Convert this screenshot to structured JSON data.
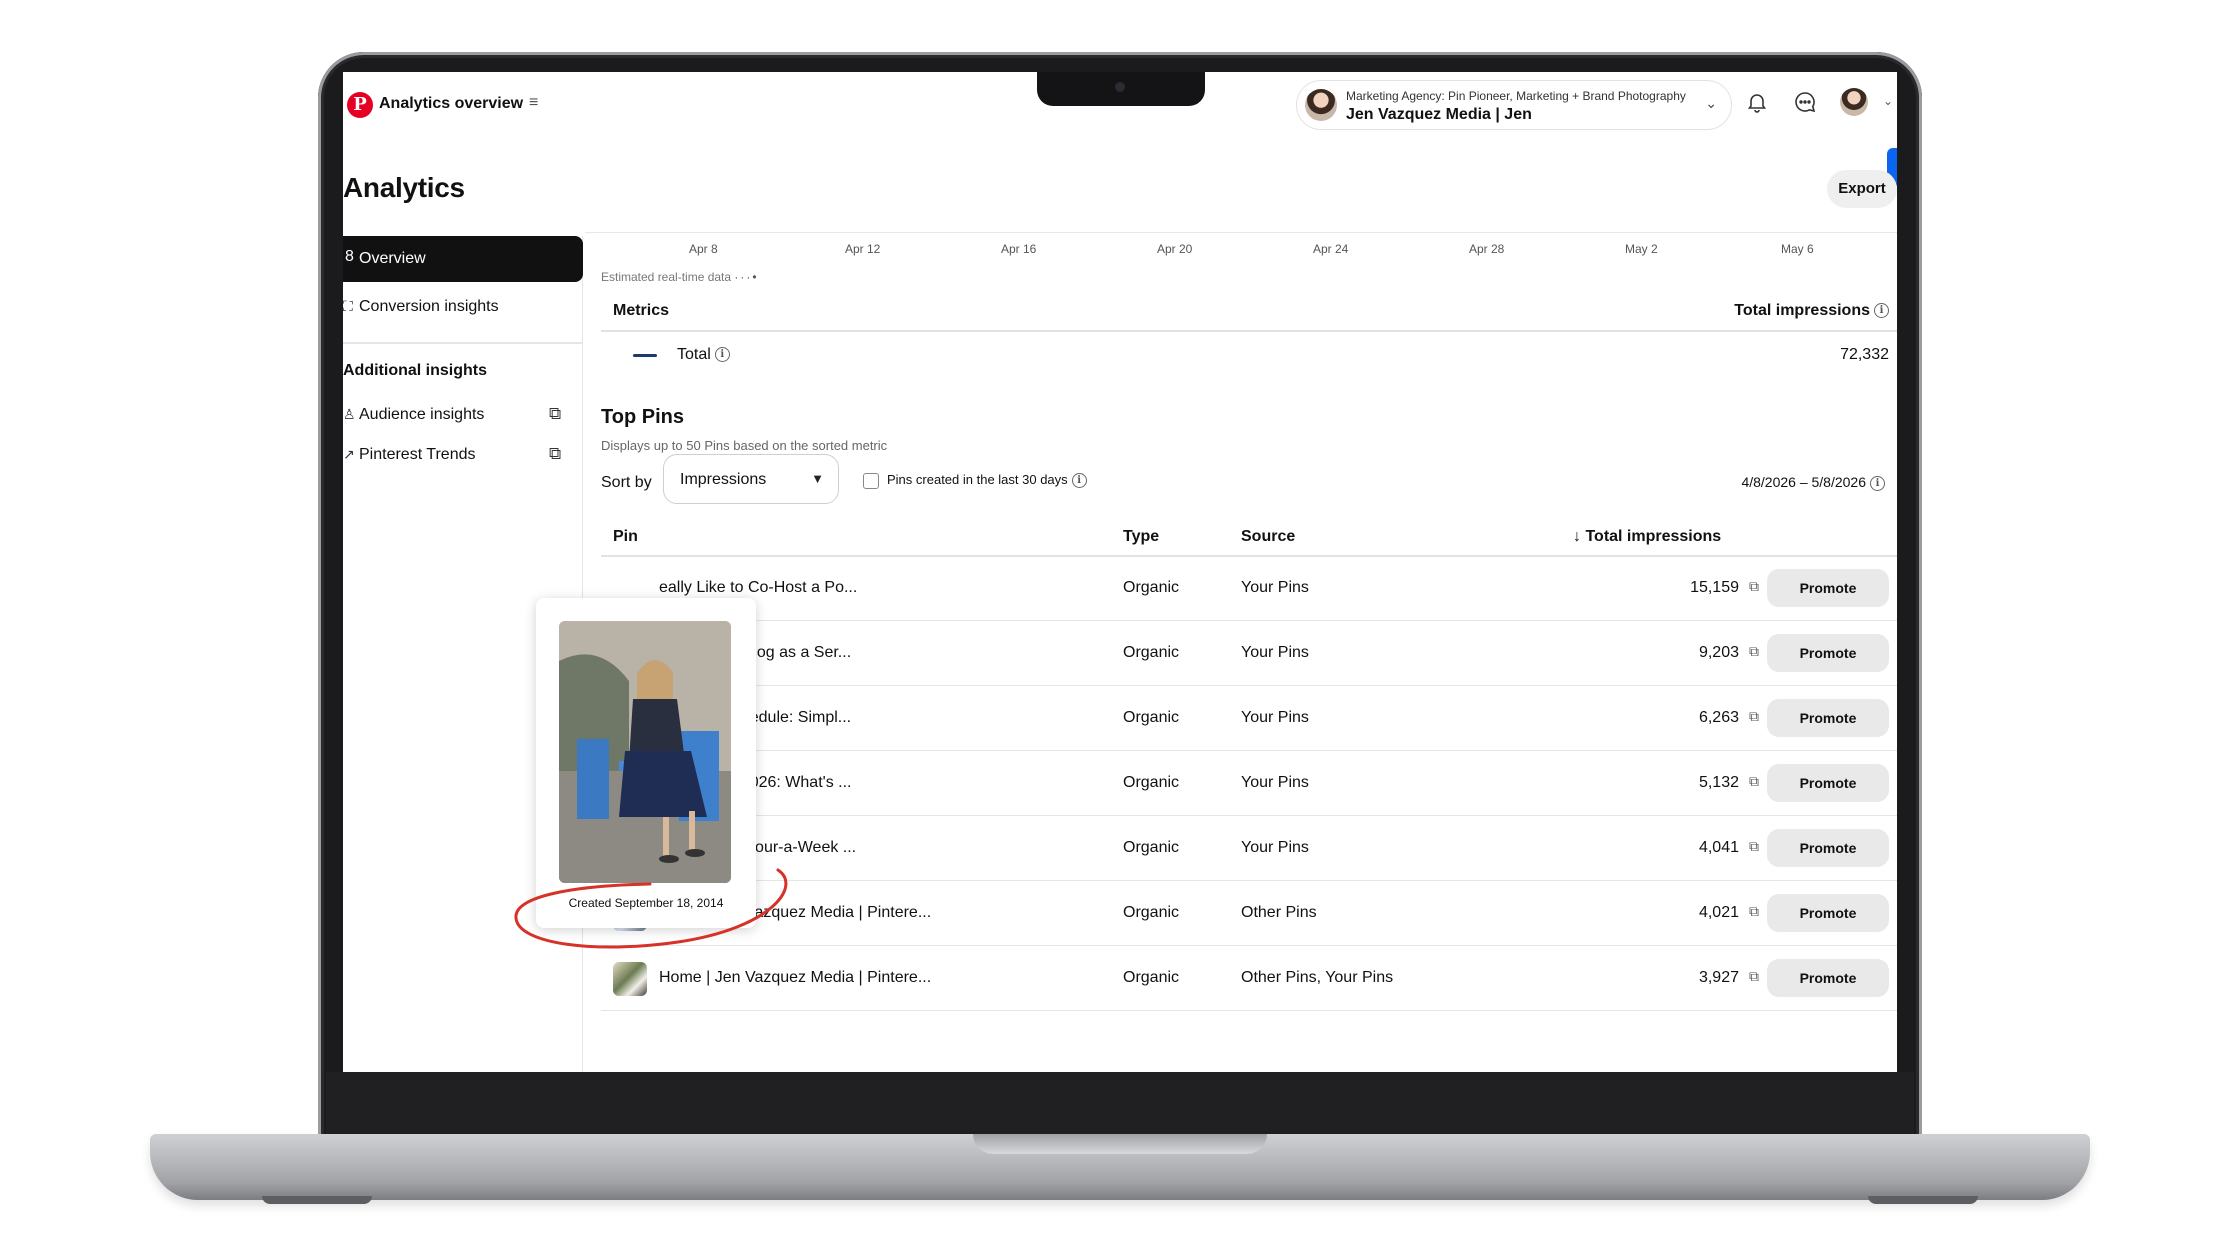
{
  "header": {
    "page_title": "Analytics overview",
    "account_description": "Marketing Agency: Pin Pioneer, Marketing + Brand Photography",
    "account_name": "Jen Vazquez Media | Jen"
  },
  "page": {
    "title": "Analytics",
    "export_label": "Export"
  },
  "sidebar": {
    "items": [
      {
        "label": "Overview",
        "icon": "overview-icon",
        "active": true
      },
      {
        "label": "Conversion insights",
        "icon": "conversion-icon"
      }
    ],
    "section_title": "Additional insights",
    "external_items": [
      {
        "label": "Audience insights",
        "icon": "audience-icon"
      },
      {
        "label": "Pinterest Trends",
        "icon": "trend-arrow-icon"
      }
    ]
  },
  "chart_axis": {
    "ticks": [
      "Apr 8",
      "Apr 12",
      "Apr 16",
      "Apr 20",
      "Apr 24",
      "Apr 28",
      "May 2",
      "May 6"
    ],
    "realtime_note": "Estimated real-time data"
  },
  "metrics": {
    "header": "Metrics",
    "column": "Total impressions",
    "total_label": "Total",
    "total_value": "72,332",
    "total_color": "#1d3b6f"
  },
  "top_pins": {
    "title": "Top Pins",
    "subtitle": "Displays up to 50 Pins based on the sorted metric",
    "sort_label": "Sort by",
    "sort_value": "Impressions",
    "checkbox_label": "Pins created in the last 30 days",
    "date_range": "4/8/2026 – 5/8/2026",
    "columns": {
      "pin": "Pin",
      "type": "Type",
      "source": "Source",
      "impressions": "Total impressions"
    },
    "promote_label": "Promote",
    "rows": [
      {
        "title": "eally Like to Co-Host a Po...",
        "type": "Organic",
        "source": "Your Pins",
        "impressions": "15,159"
      },
      {
        "title": "netize Your Blog as a Ser...",
        "type": "Organic",
        "source": "Your Pins",
        "impressions": "9,203"
      },
      {
        "title": "oof Your Schedule: Simpl...",
        "type": "Organic",
        "source": "Your Pins",
        "impressions": "6,263"
      },
      {
        "title": "larketing in 2026: What's ...",
        "type": "Organic",
        "source": "Your Pins",
        "impressions": "5,132"
      },
      {
        "title": "eate a One-Hour-a-Week ...",
        "type": "Organic",
        "source": "Your Pins",
        "impressions": "4,041"
      },
      {
        "title": "Home | Jen Vazquez Media | Pintere...",
        "type": "Organic",
        "source": "Other Pins",
        "impressions": "4,021"
      },
      {
        "title": "Home | Jen Vazquez Media | Pintere...",
        "type": "Organic",
        "source": "Other Pins, Your Pins",
        "impressions": "3,927"
      }
    ]
  },
  "hover_card": {
    "created": "Created September 18, 2014",
    "annotation_color": "#d63228"
  }
}
